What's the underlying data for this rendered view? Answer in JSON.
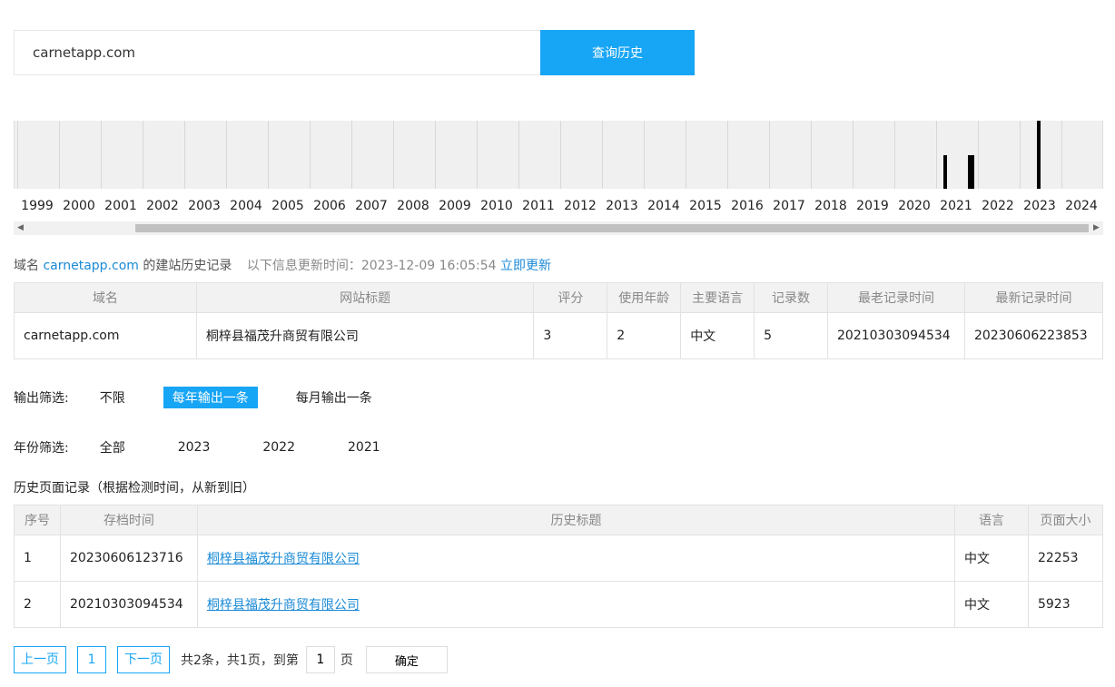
{
  "search": {
    "value": "carnetapp.com",
    "button_label": "查询历史"
  },
  "timeline": {
    "years": [
      "1999",
      "2000",
      "2001",
      "2002",
      "2003",
      "2004",
      "2005",
      "2006",
      "2007",
      "2008",
      "2009",
      "2010",
      "2011",
      "2012",
      "2013",
      "2014",
      "2015",
      "2016",
      "2017",
      "2018",
      "2019",
      "2020",
      "2021",
      "2022",
      "2023",
      "2024"
    ],
    "records": [
      {
        "year": "2021",
        "month": 3,
        "level": 0.49
      },
      {
        "year": "2021",
        "month": 10,
        "level": 0.49
      },
      {
        "year": "2021",
        "month": 11,
        "level": 0.49
      },
      {
        "year": "2023",
        "month": 6,
        "level": 1.0
      }
    ]
  },
  "info": {
    "prefix": "域名",
    "domain": "carnetapp.com",
    "suffix": "的建站历史记录",
    "update_label": "以下信息更新时间：2023-12-09 16:05:54",
    "update_link": "立即更新"
  },
  "summary_table": {
    "headers": [
      "域名",
      "网站标题",
      "评分",
      "使用年龄",
      "主要语言",
      "记录数",
      "最老记录时间",
      "最新记录时间"
    ],
    "row": [
      "carnetapp.com",
      "桐梓县福茂升商贸有限公司",
      "3",
      "2",
      "中文",
      "5",
      "20210303094534",
      "20230606223853"
    ]
  },
  "output_filter": {
    "label": "输出筛选:",
    "options": [
      "不限",
      "每年输出一条",
      "每月输出一条"
    ],
    "active": 1
  },
  "year_filter": {
    "label": "年份筛选:",
    "options": [
      "全部",
      "2023",
      "2022",
      "2021"
    ]
  },
  "history": {
    "title": "历史页面记录（根据检测时间，从新到旧）",
    "headers": [
      "序号",
      "存档时间",
      "历史标题",
      "语言",
      "页面大小"
    ],
    "rows": [
      [
        "1",
        "20230606123716",
        "桐梓县福茂升商贸有限公司",
        "中文",
        "22253"
      ],
      [
        "2",
        "20210303094534",
        "桐梓县福茂升商贸有限公司",
        "中文",
        "5923"
      ]
    ]
  },
  "pager": {
    "prev": "上一页",
    "page": "1",
    "next": "下一页",
    "summary": "共2条，共1页，到第",
    "goto_value": "1",
    "page_unit": "页",
    "ok": "确定"
  }
}
